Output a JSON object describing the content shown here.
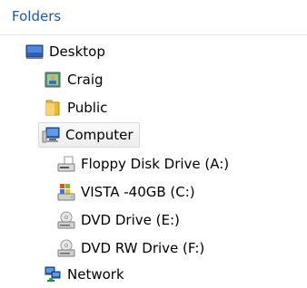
{
  "panel": {
    "title": "Folders"
  },
  "tree": {
    "desktop": {
      "label": "Desktop",
      "icon": "desktop-icon"
    },
    "craig": {
      "label": "Craig",
      "icon": "user-folder-icon"
    },
    "public": {
      "label": "Public",
      "icon": "folder-icon"
    },
    "computer": {
      "label": "Computer",
      "icon": "computer-icon",
      "selected": true
    },
    "floppy": {
      "label": "Floppy Disk Drive (A:)",
      "icon": "floppy-drive-icon"
    },
    "vista": {
      "label": "VISTA -40GB (C:)",
      "icon": "windows-drive-icon"
    },
    "dvd": {
      "label": "DVD Drive (E:)",
      "icon": "dvd-drive-icon"
    },
    "dvdrw": {
      "label": "DVD RW Drive (F:)",
      "icon": "dvd-rw-drive-icon"
    },
    "network": {
      "label": "Network",
      "icon": "network-icon"
    }
  },
  "colors": {
    "header_text": "#1e5aa8",
    "selection_border": "#d9d9d9"
  }
}
